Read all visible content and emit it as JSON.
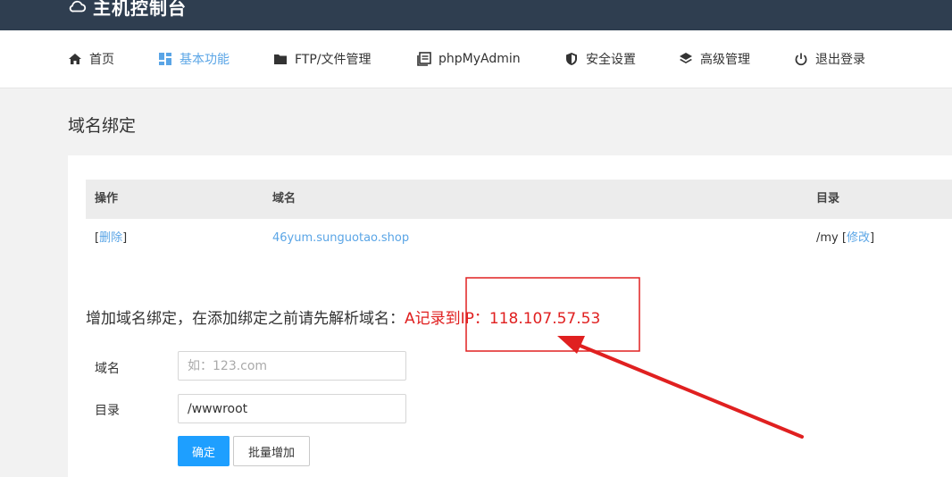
{
  "brand": {
    "title": "主机控制台",
    "icon": "cloud-icon"
  },
  "nav": [
    {
      "label": "首页",
      "icon": "home-icon"
    },
    {
      "label": "基本功能",
      "icon": "grid-icon",
      "active": true
    },
    {
      "label": "FTP/文件管理",
      "icon": "folder-icon"
    },
    {
      "label": "phpMyAdmin",
      "icon": "database-icon"
    },
    {
      "label": "安全设置",
      "icon": "shield-icon"
    },
    {
      "label": "高级管理",
      "icon": "layers-icon"
    },
    {
      "label": "退出登录",
      "icon": "power-icon"
    }
  ],
  "page": {
    "title": "域名绑定"
  },
  "table": {
    "headers": [
      "操作",
      "域名",
      "目录"
    ],
    "rows": [
      {
        "delete": "删除",
        "domain": "46yum.sunguotao.shop",
        "dir": "/my",
        "edit": "修改"
      }
    ]
  },
  "notice": {
    "text": "增加域名绑定，在添加绑定之前请先解析域名：",
    "highlight": "A记录到IP：118.107.57.53"
  },
  "form": {
    "domain_label": "域名",
    "domain_placeholder": "如：123.com",
    "dir_label": "目录",
    "dir_value": "/wwwroot",
    "confirm_label": "确定",
    "batch_label": "批量增加"
  },
  "colors": {
    "topbar": "#2f3e50",
    "accent": "#5aa5e6",
    "primary_button": "#1e9fff",
    "annotation": "#e02020"
  }
}
